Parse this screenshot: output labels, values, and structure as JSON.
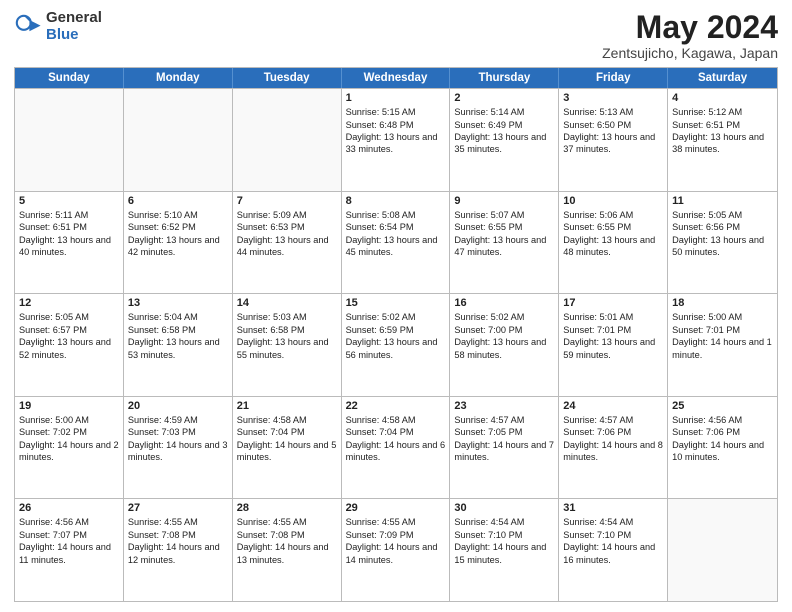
{
  "logo": {
    "general": "General",
    "blue": "Blue"
  },
  "title": {
    "month": "May 2024",
    "location": "Zentsujicho, Kagawa, Japan"
  },
  "calendar": {
    "headers": [
      "Sunday",
      "Monday",
      "Tuesday",
      "Wednesday",
      "Thursday",
      "Friday",
      "Saturday"
    ],
    "weeks": [
      [
        {
          "day": "",
          "empty": true
        },
        {
          "day": "",
          "empty": true
        },
        {
          "day": "",
          "empty": true
        },
        {
          "day": "1",
          "sunrise": "5:15 AM",
          "sunset": "6:48 PM",
          "daylight": "13 hours and 33 minutes."
        },
        {
          "day": "2",
          "sunrise": "5:14 AM",
          "sunset": "6:49 PM",
          "daylight": "13 hours and 35 minutes."
        },
        {
          "day": "3",
          "sunrise": "5:13 AM",
          "sunset": "6:50 PM",
          "daylight": "13 hours and 37 minutes."
        },
        {
          "day": "4",
          "sunrise": "5:12 AM",
          "sunset": "6:51 PM",
          "daylight": "13 hours and 38 minutes."
        }
      ],
      [
        {
          "day": "5",
          "sunrise": "5:11 AM",
          "sunset": "6:51 PM",
          "daylight": "13 hours and 40 minutes."
        },
        {
          "day": "6",
          "sunrise": "5:10 AM",
          "sunset": "6:52 PM",
          "daylight": "13 hours and 42 minutes."
        },
        {
          "day": "7",
          "sunrise": "5:09 AM",
          "sunset": "6:53 PM",
          "daylight": "13 hours and 44 minutes."
        },
        {
          "day": "8",
          "sunrise": "5:08 AM",
          "sunset": "6:54 PM",
          "daylight": "13 hours and 45 minutes."
        },
        {
          "day": "9",
          "sunrise": "5:07 AM",
          "sunset": "6:55 PM",
          "daylight": "13 hours and 47 minutes."
        },
        {
          "day": "10",
          "sunrise": "5:06 AM",
          "sunset": "6:55 PM",
          "daylight": "13 hours and 48 minutes."
        },
        {
          "day": "11",
          "sunrise": "5:05 AM",
          "sunset": "6:56 PM",
          "daylight": "13 hours and 50 minutes."
        }
      ],
      [
        {
          "day": "12",
          "sunrise": "5:05 AM",
          "sunset": "6:57 PM",
          "daylight": "13 hours and 52 minutes."
        },
        {
          "day": "13",
          "sunrise": "5:04 AM",
          "sunset": "6:58 PM",
          "daylight": "13 hours and 53 minutes."
        },
        {
          "day": "14",
          "sunrise": "5:03 AM",
          "sunset": "6:58 PM",
          "daylight": "13 hours and 55 minutes."
        },
        {
          "day": "15",
          "sunrise": "5:02 AM",
          "sunset": "6:59 PM",
          "daylight": "13 hours and 56 minutes."
        },
        {
          "day": "16",
          "sunrise": "5:02 AM",
          "sunset": "7:00 PM",
          "daylight": "13 hours and 58 minutes."
        },
        {
          "day": "17",
          "sunrise": "5:01 AM",
          "sunset": "7:01 PM",
          "daylight": "13 hours and 59 minutes."
        },
        {
          "day": "18",
          "sunrise": "5:00 AM",
          "sunset": "7:01 PM",
          "daylight": "14 hours and 1 minute."
        }
      ],
      [
        {
          "day": "19",
          "sunrise": "5:00 AM",
          "sunset": "7:02 PM",
          "daylight": "14 hours and 2 minutes."
        },
        {
          "day": "20",
          "sunrise": "4:59 AM",
          "sunset": "7:03 PM",
          "daylight": "14 hours and 3 minutes."
        },
        {
          "day": "21",
          "sunrise": "4:58 AM",
          "sunset": "7:04 PM",
          "daylight": "14 hours and 5 minutes."
        },
        {
          "day": "22",
          "sunrise": "4:58 AM",
          "sunset": "7:04 PM",
          "daylight": "14 hours and 6 minutes."
        },
        {
          "day": "23",
          "sunrise": "4:57 AM",
          "sunset": "7:05 PM",
          "daylight": "14 hours and 7 minutes."
        },
        {
          "day": "24",
          "sunrise": "4:57 AM",
          "sunset": "7:06 PM",
          "daylight": "14 hours and 8 minutes."
        },
        {
          "day": "25",
          "sunrise": "4:56 AM",
          "sunset": "7:06 PM",
          "daylight": "14 hours and 10 minutes."
        }
      ],
      [
        {
          "day": "26",
          "sunrise": "4:56 AM",
          "sunset": "7:07 PM",
          "daylight": "14 hours and 11 minutes."
        },
        {
          "day": "27",
          "sunrise": "4:55 AM",
          "sunset": "7:08 PM",
          "daylight": "14 hours and 12 minutes."
        },
        {
          "day": "28",
          "sunrise": "4:55 AM",
          "sunset": "7:08 PM",
          "daylight": "14 hours and 13 minutes."
        },
        {
          "day": "29",
          "sunrise": "4:55 AM",
          "sunset": "7:09 PM",
          "daylight": "14 hours and 14 minutes."
        },
        {
          "day": "30",
          "sunrise": "4:54 AM",
          "sunset": "7:10 PM",
          "daylight": "14 hours and 15 minutes."
        },
        {
          "day": "31",
          "sunrise": "4:54 AM",
          "sunset": "7:10 PM",
          "daylight": "14 hours and 16 minutes."
        },
        {
          "day": "",
          "empty": true
        }
      ]
    ]
  }
}
